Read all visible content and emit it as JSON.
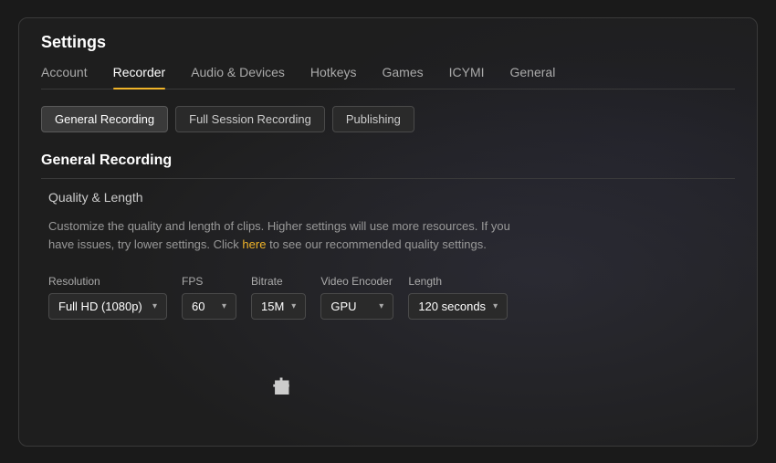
{
  "window": {
    "title": "Settings"
  },
  "nav": {
    "tabs": [
      {
        "id": "account",
        "label": "Account",
        "active": false
      },
      {
        "id": "recorder",
        "label": "Recorder",
        "active": true
      },
      {
        "id": "audio-devices",
        "label": "Audio & Devices",
        "active": false
      },
      {
        "id": "hotkeys",
        "label": "Hotkeys",
        "active": false
      },
      {
        "id": "games",
        "label": "Games",
        "active": false
      },
      {
        "id": "icymi",
        "label": "ICYMI",
        "active": false
      },
      {
        "id": "general",
        "label": "General",
        "active": false
      }
    ]
  },
  "sub_tabs": [
    {
      "id": "general-recording",
      "label": "General Recording",
      "active": true
    },
    {
      "id": "full-session",
      "label": "Full Session Recording",
      "active": false
    },
    {
      "id": "publishing",
      "label": "Publishing",
      "active": false
    }
  ],
  "section": {
    "title": "General Recording"
  },
  "quality_section": {
    "label": "Quality & Length",
    "description_1": "Customize the quality and length of clips. Higher settings will use more resources. If you have issues, try lower settings. Click",
    "link_text": "here",
    "description_2": "to see our recommended quality settings."
  },
  "controls": [
    {
      "id": "resolution",
      "label": "Resolution",
      "value": "Full HD (1080p)",
      "width": "wide"
    },
    {
      "id": "fps",
      "label": "FPS",
      "value": "60",
      "width": "small"
    },
    {
      "id": "bitrate",
      "label": "Bitrate",
      "value": "15M",
      "width": "small"
    },
    {
      "id": "video-encoder",
      "label": "Video Encoder",
      "value": "GPU",
      "width": "medium"
    },
    {
      "id": "length",
      "label": "Length",
      "value": "120 seconds",
      "width": "medium"
    }
  ]
}
